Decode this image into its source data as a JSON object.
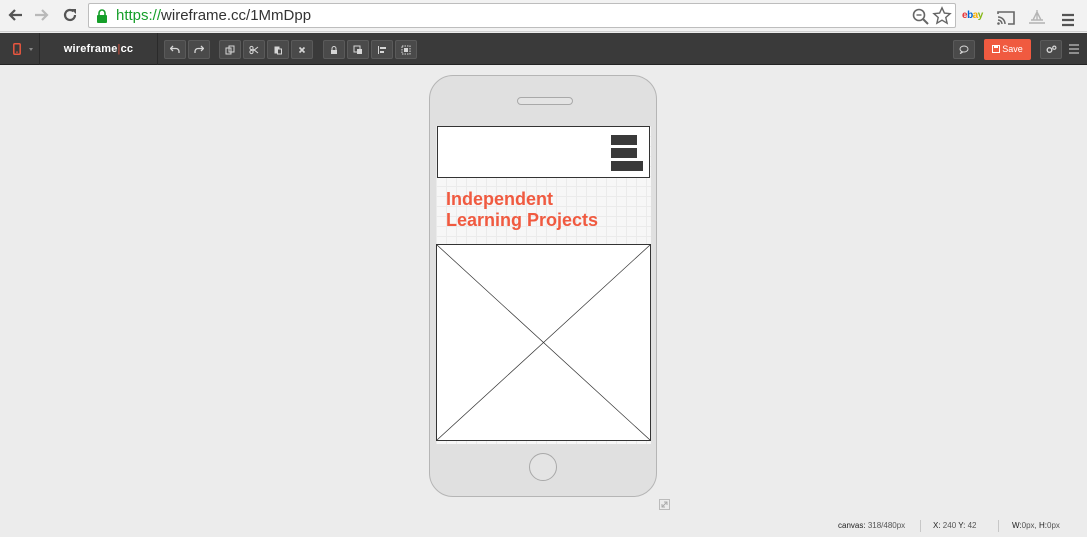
{
  "browser": {
    "url_protocol": "https://",
    "url_rest": "wireframe.cc/1MmDpp"
  },
  "app": {
    "brand_left": "wireframe",
    "brand_sep": "|",
    "brand_right": "cc",
    "save_label": "Save"
  },
  "icons": {
    "back": "back-arrow-icon",
    "forward": "forward-arrow-icon",
    "reload": "reload-icon",
    "lock": "lock-icon",
    "zoom": "zoom-icon",
    "bookmark": "star-icon",
    "cast": "cast-icon",
    "menu": "hamburger-icon"
  },
  "wireframe": {
    "headline_line1": "Independent",
    "headline_line2": "Learning Projects"
  },
  "status": {
    "canvas_label": "canvas:",
    "canvas_value": "318/480px",
    "x_label": "X:",
    "x_value": "240",
    "y_label": "Y:",
    "y_value": "42",
    "w_label": "W:",
    "w_value": "0px,",
    "h_label": "H:",
    "h_value": "0px"
  },
  "colors": {
    "accent": "#f05a40",
    "toolbar": "#3a3a3a",
    "url_secure": "#169f2a"
  }
}
